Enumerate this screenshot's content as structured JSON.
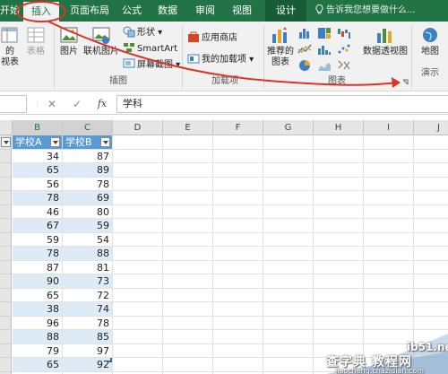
{
  "ribbon": {
    "tabs": [
      {
        "label": "开始",
        "active": false
      },
      {
        "label": "插入",
        "active": true
      },
      {
        "label": "页面布局",
        "active": false
      },
      {
        "label": "公式",
        "active": false
      },
      {
        "label": "数据",
        "active": false
      },
      {
        "label": "审阅",
        "active": false
      },
      {
        "label": "视图",
        "active": false
      },
      {
        "label": "设计",
        "active": false
      }
    ],
    "tell_me": "告诉我您想要做什么...",
    "buttons": {
      "pivot_partial_1": "的",
      "pivot_partial_2": "视表",
      "table": "表格",
      "picture": "图片",
      "online_picture": "联机图片",
      "shapes": "形状",
      "smartart": "SmartArt",
      "screenshot": "屏幕截图",
      "app_store": "应用商店",
      "my_addins": "我的加载项",
      "recommended_charts_1": "推荐的",
      "recommended_charts_2": "图表",
      "pivot_chart": "数据透视图",
      "map_1": "地图",
      "map_2": "演示"
    },
    "groups": {
      "illustrations": "插图",
      "addins": "加载项",
      "charts": "图表"
    },
    "colors": {
      "ribbon_green": "#217346",
      "annotation_red": "#d9342b",
      "table_header": "#5b9bd5",
      "table_band": "#ddebf7"
    }
  },
  "formula_bar": {
    "cancel_icon": "✕",
    "enter_icon": "✓",
    "fx_label": "fx",
    "value": "学科"
  },
  "sheet": {
    "columns": [
      "B",
      "C",
      "D",
      "E",
      "F",
      "G",
      "H",
      "I",
      "J"
    ],
    "table_headers": [
      "学校A",
      "学校B"
    ],
    "rows": [
      [
        34,
        87
      ],
      [
        65,
        89
      ],
      [
        56,
        78
      ],
      [
        78,
        69
      ],
      [
        46,
        80
      ],
      [
        67,
        59
      ],
      [
        59,
        54
      ],
      [
        78,
        88
      ],
      [
        87,
        81
      ],
      [
        90,
        73
      ],
      [
        65,
        72
      ],
      [
        38,
        74
      ],
      [
        96,
        78
      ],
      [
        88,
        85
      ],
      [
        79,
        97
      ],
      [
        65,
        92
      ]
    ]
  },
  "watermark": {
    "site": "ib51.net",
    "main": "查字典 教程网",
    "url": "jiaocheng.chazidian.com"
  }
}
